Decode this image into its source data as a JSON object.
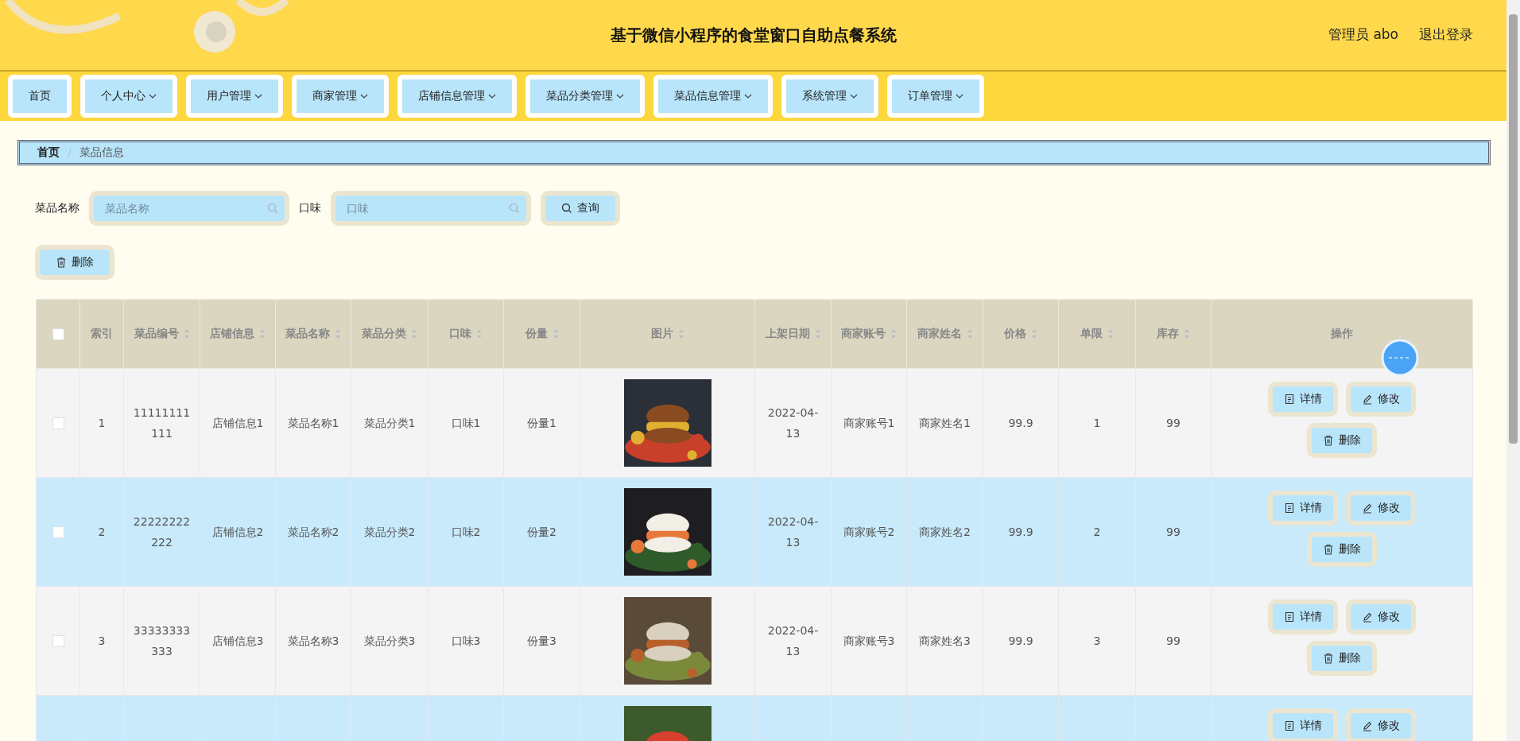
{
  "header": {
    "title": "基于微信小程序的食堂窗口自助点餐系统",
    "user": "管理员 abo",
    "logout": "退出登录"
  },
  "nav": [
    {
      "label": "首页",
      "dropdown": false
    },
    {
      "label": "个人中心",
      "dropdown": true
    },
    {
      "label": "用户管理",
      "dropdown": true
    },
    {
      "label": "商家管理",
      "dropdown": true
    },
    {
      "label": "店铺信息管理",
      "dropdown": true
    },
    {
      "label": "菜品分类管理",
      "dropdown": true
    },
    {
      "label": "菜品信息管理",
      "dropdown": true
    },
    {
      "label": "系统管理",
      "dropdown": true
    },
    {
      "label": "订单管理",
      "dropdown": true
    }
  ],
  "breadcrumb": {
    "items": [
      "首页",
      "菜品信息"
    ],
    "separator": "/"
  },
  "search": {
    "fields": [
      {
        "label": "菜品名称",
        "placeholder": "菜品名称"
      },
      {
        "label": "口味",
        "placeholder": "口味"
      }
    ],
    "button": "查询"
  },
  "delete_button": "删除",
  "table": {
    "header_checked": false,
    "columns": [
      {
        "kind": "checkbox"
      },
      {
        "kind": "text",
        "label": "索引",
        "sortable": false
      },
      {
        "kind": "text",
        "label": "菜品编号",
        "sortable": true
      },
      {
        "kind": "text",
        "label": "店铺信息",
        "sortable": true
      },
      {
        "kind": "text",
        "label": "菜品名称",
        "sortable": true
      },
      {
        "kind": "text",
        "label": "菜品分类",
        "sortable": true
      },
      {
        "kind": "text",
        "label": "口味",
        "sortable": true
      },
      {
        "kind": "text",
        "label": "份量",
        "sortable": true
      },
      {
        "kind": "picture",
        "label": "图片",
        "sortable": true
      },
      {
        "kind": "text",
        "label": "上架日期",
        "sortable": true
      },
      {
        "kind": "text",
        "label": "商家账号",
        "sortable": true
      },
      {
        "kind": "text",
        "label": "商家姓名",
        "sortable": true
      },
      {
        "kind": "text",
        "label": "价格",
        "sortable": true
      },
      {
        "kind": "text",
        "label": "单限",
        "sortable": true
      },
      {
        "kind": "text",
        "label": "库存",
        "sortable": true
      },
      {
        "kind": "actions",
        "label": "操作",
        "sortable": false
      }
    ],
    "rows": [
      {
        "checked": false,
        "cells": [
          "1",
          "11111111111",
          "店铺信息1",
          "菜品名称1",
          "菜品分类1",
          "口味1",
          "份量1",
          "2022-04-13",
          "商家账号1",
          "商家姓名1",
          "99.9",
          "1",
          "99"
        ],
        "actions": [
          "详情",
          "修改",
          "删除"
        ]
      },
      {
        "checked": false,
        "cells": [
          "2",
          "22222222222",
          "店铺信息2",
          "菜品名称2",
          "菜品分类2",
          "口味2",
          "份量2",
          "2022-04-13",
          "商家账号2",
          "商家姓名2",
          "99.9",
          "2",
          "99"
        ],
        "actions": [
          "详情",
          "修改",
          "删除"
        ]
      },
      {
        "checked": false,
        "cells": [
          "3",
          "33333333333",
          "店铺信息3",
          "菜品名称3",
          "菜品分类3",
          "口味3",
          "份量3",
          "2022-04-13",
          "商家账号3",
          "商家姓名3",
          "99.9",
          "3",
          "99"
        ],
        "actions": [
          "详情",
          "修改",
          "删除"
        ]
      },
      {
        "actions": [
          "详情",
          "修改"
        ]
      }
    ]
  }
}
